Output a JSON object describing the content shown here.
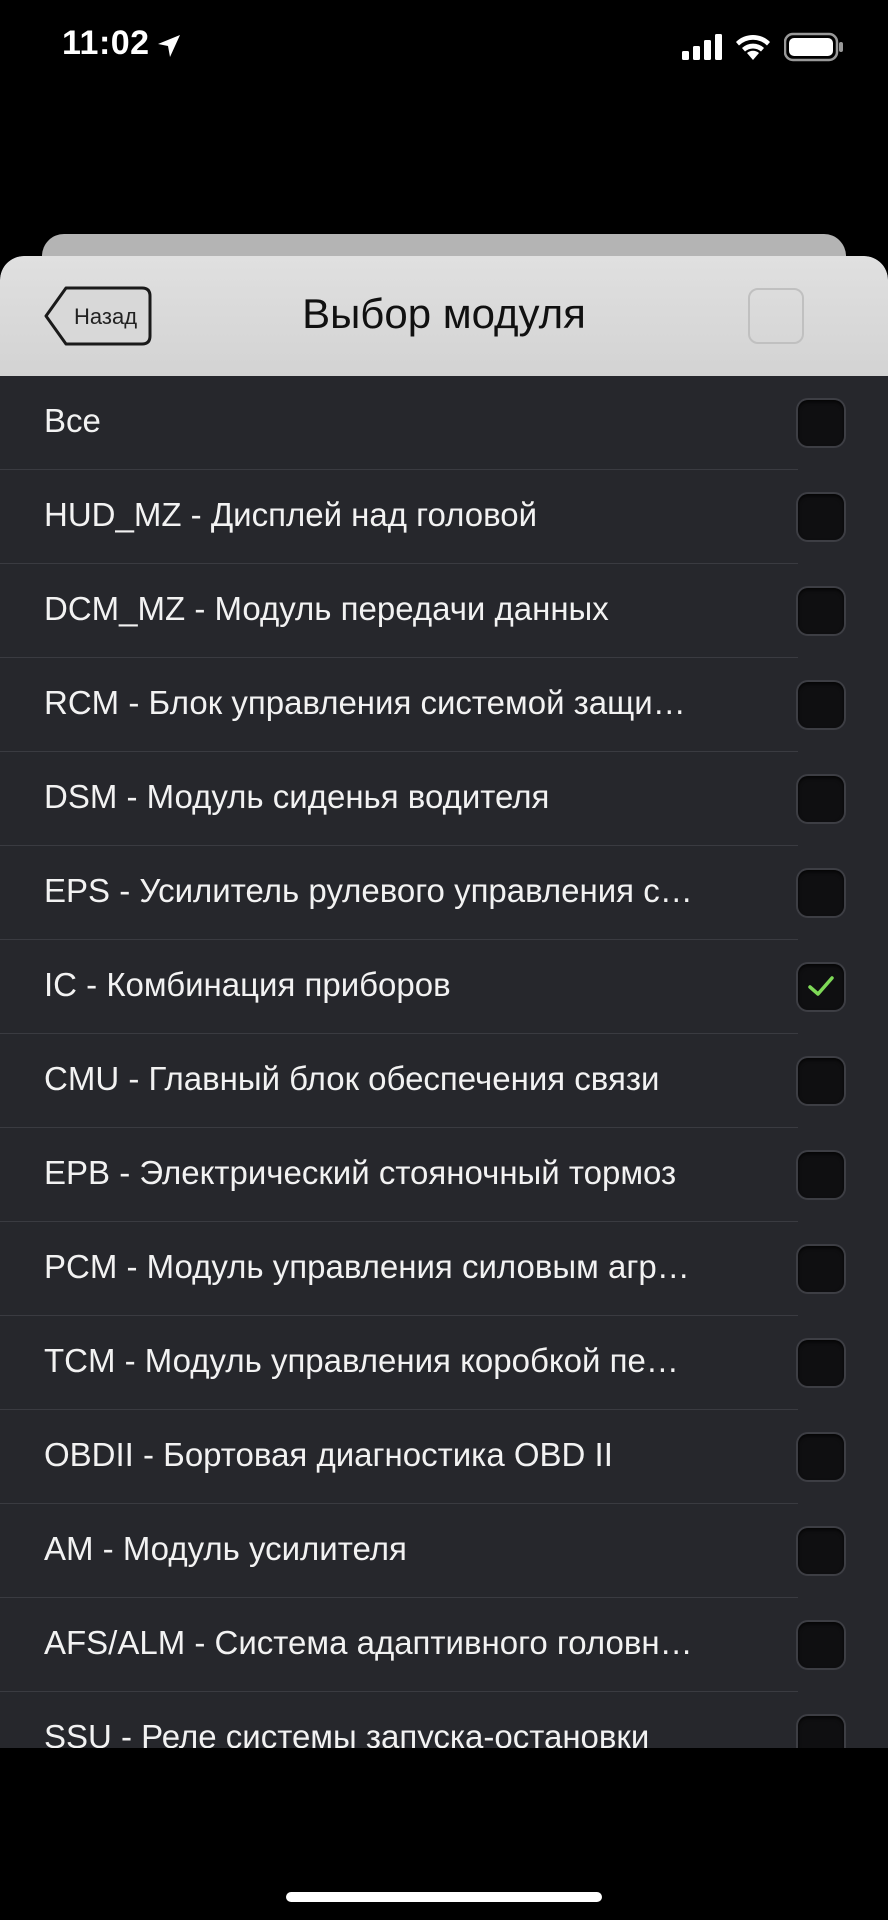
{
  "status": {
    "time": "11:02"
  },
  "nav": {
    "back_label": "Назад",
    "title": "Выбор модуля"
  },
  "accent_color": "#7ed957",
  "modules": [
    {
      "label": "Все",
      "checked": false
    },
    {
      "label": "HUD_MZ - Дисплей над головой",
      "checked": false
    },
    {
      "label": "DCM_MZ - Модуль передачи данных",
      "checked": false
    },
    {
      "label": "RCM - Блок управления системой защи…",
      "checked": false
    },
    {
      "label": "DSM - Модуль сиденья водителя",
      "checked": false
    },
    {
      "label": "EPS - Усилитель рулевого управления с…",
      "checked": false
    },
    {
      "label": "IC - Комбинация приборов",
      "checked": true
    },
    {
      "label": "CMU - Главный блок обеспечения связи",
      "checked": false
    },
    {
      "label": "EPB - Электрический стояночный тормоз",
      "checked": false
    },
    {
      "label": "PCM - Модуль управления силовым агр…",
      "checked": false
    },
    {
      "label": "TCM - Модуль управления коробкой пе…",
      "checked": false
    },
    {
      "label": "OBDII - Бортовая диагностика OBD II",
      "checked": false
    },
    {
      "label": "AM - Модуль усилителя",
      "checked": false
    },
    {
      "label": "AFS/ALM - Система адаптивного головн…",
      "checked": false
    },
    {
      "label": "SSU - Реле системы запуска-остановки",
      "checked": false
    }
  ]
}
